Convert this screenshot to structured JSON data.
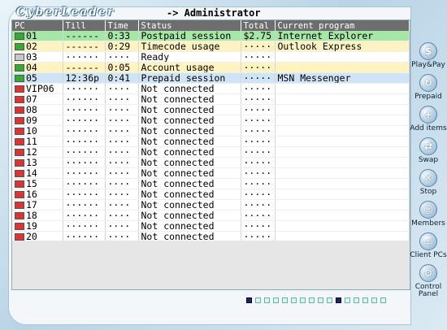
{
  "header": {
    "logo": "CyberLeader",
    "admin": "-> Administrator"
  },
  "columns": [
    "PC",
    "Till",
    "Time",
    "Status",
    "Total",
    "Current program"
  ],
  "rows": [
    {
      "pc": "01",
      "till": "------",
      "time": "0:33",
      "status": "Postpaid session",
      "total": "$2.75",
      "program": "Internet Explorer",
      "bg": "#a6e6a6",
      "icon": "#33aa33"
    },
    {
      "pc": "02",
      "till": "------",
      "time": "0:29",
      "status": "Timecode usage",
      "total": "·····",
      "program": "Outlook Express",
      "bg": "#fff3c2",
      "icon": "#33aa33"
    },
    {
      "pc": "03",
      "till": "······",
      "time": "····",
      "status": "Ready",
      "total": "·····",
      "program": "",
      "bg": "#ffffff",
      "icon": "#c8c8c8"
    },
    {
      "pc": "04",
      "till": "------",
      "time": "0:05",
      "status": "Account usage",
      "total": "·····",
      "program": "",
      "bg": "#fff3c2",
      "icon": "#33aa33"
    },
    {
      "pc": "05",
      "till": "12:36p",
      "time": "0:41",
      "status": "Prepaid session",
      "total": "·····",
      "program": "MSN Messenger",
      "bg": "#cfe4f6",
      "icon": "#33aa33"
    },
    {
      "pc": "VIP06",
      "till": "······",
      "time": "····",
      "status": "Not connected",
      "total": "·····",
      "program": "",
      "bg": "#ffffff",
      "icon": "#dd3333"
    },
    {
      "pc": "07",
      "till": "······",
      "time": "····",
      "status": "Not connected",
      "total": "·····",
      "program": "",
      "bg": "#ffffff",
      "icon": "#dd3333"
    },
    {
      "pc": "08",
      "till": "······",
      "time": "····",
      "status": "Not connected",
      "total": "·····",
      "program": "",
      "bg": "#ffffff",
      "icon": "#dd3333"
    },
    {
      "pc": "09",
      "till": "······",
      "time": "····",
      "status": "Not connected",
      "total": "·····",
      "program": "",
      "bg": "#ffffff",
      "icon": "#dd3333"
    },
    {
      "pc": "10",
      "till": "······",
      "time": "····",
      "status": "Not connected",
      "total": "·····",
      "program": "",
      "bg": "#ffffff",
      "icon": "#dd3333"
    },
    {
      "pc": "11",
      "till": "······",
      "time": "····",
      "status": "Not connected",
      "total": "·····",
      "program": "",
      "bg": "#ffffff",
      "icon": "#dd3333"
    },
    {
      "pc": "12",
      "till": "······",
      "time": "····",
      "status": "Not connected",
      "total": "·····",
      "program": "",
      "bg": "#ffffff",
      "icon": "#dd3333"
    },
    {
      "pc": "13",
      "till": "······",
      "time": "····",
      "status": "Not connected",
      "total": "·····",
      "program": "",
      "bg": "#ffffff",
      "icon": "#dd3333"
    },
    {
      "pc": "14",
      "till": "······",
      "time": "····",
      "status": "Not connected",
      "total": "·····",
      "program": "",
      "bg": "#ffffff",
      "icon": "#dd3333"
    },
    {
      "pc": "15",
      "till": "······",
      "time": "····",
      "status": "Not connected",
      "total": "·····",
      "program": "",
      "bg": "#ffffff",
      "icon": "#dd3333"
    },
    {
      "pc": "16",
      "till": "······",
      "time": "····",
      "status": "Not connected",
      "total": "·····",
      "program": "",
      "bg": "#ffffff",
      "icon": "#dd3333"
    },
    {
      "pc": "17",
      "till": "······",
      "time": "····",
      "status": "Not connected",
      "total": "·····",
      "program": "",
      "bg": "#ffffff",
      "icon": "#dd3333"
    },
    {
      "pc": "18",
      "till": "······",
      "time": "····",
      "status": "Not connected",
      "total": "·····",
      "program": "",
      "bg": "#ffffff",
      "icon": "#dd3333"
    },
    {
      "pc": "19",
      "till": "······",
      "time": "····",
      "status": "Not connected",
      "total": "·····",
      "program": "",
      "bg": "#ffffff",
      "icon": "#dd3333"
    },
    {
      "pc": "20",
      "till": "······",
      "time": "····",
      "status": "Not connected",
      "total": "·····",
      "program": "",
      "bg": "#ffffff",
      "icon": "#dd3333"
    }
  ],
  "sidebar": [
    {
      "label": "Play&Pay",
      "icon": "$",
      "name": "play-pay"
    },
    {
      "label": "Prepaid",
      "icon": "↻",
      "name": "prepaid"
    },
    {
      "label": "Add items",
      "icon": "+",
      "name": "add-items"
    },
    {
      "label": "Swap",
      "icon": "⇄",
      "name": "swap"
    },
    {
      "label": "Stop",
      "icon": "✕",
      "name": "stop"
    },
    {
      "label": "Members",
      "icon": "☺",
      "name": "members"
    },
    {
      "label": "Client PCs",
      "icon": "▭",
      "name": "client-pcs"
    },
    {
      "label": "Control Panel",
      "icon": "⚙",
      "name": "control-panel"
    }
  ],
  "pager": {
    "count": 16,
    "active": [
      0,
      10
    ]
  }
}
